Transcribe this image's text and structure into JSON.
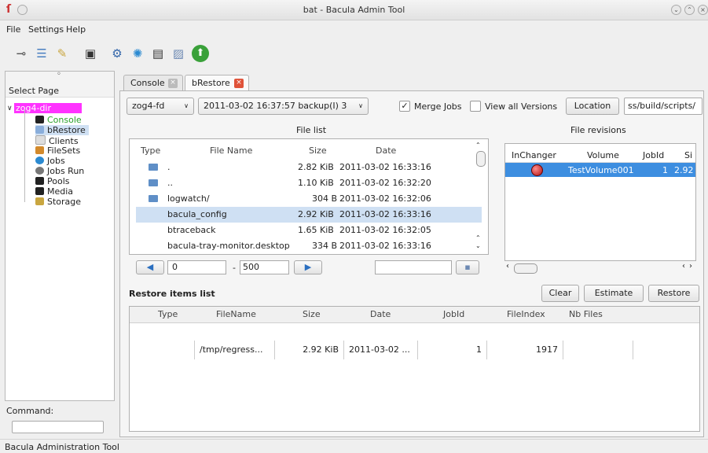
{
  "window": {
    "title": "bat - Bacula Admin Tool"
  },
  "menu": {
    "file": "File",
    "settings": "Settings",
    "help": "Help"
  },
  "sidebar": {
    "header": "Select Page",
    "root": "zog4-dir",
    "items": [
      "Console",
      "bRestore",
      "Clients",
      "FileSets",
      "Jobs",
      "Jobs Run",
      "Pools",
      "Media",
      "Storage"
    ]
  },
  "command": {
    "label": "Command:",
    "value": ""
  },
  "status": {
    "text": "Bacula Administration Tool"
  },
  "tabs": [
    {
      "label": "Console"
    },
    {
      "label": "bRestore"
    }
  ],
  "restore": {
    "client": "zog4-fd",
    "job": "2011-03-02 16:37:57 backup(I) 3",
    "merge_jobs": "Merge Jobs",
    "view_all_versions": "View all Versions",
    "location_button": "Location",
    "location_value": "ss/build/scripts/",
    "file_list_title": "File list",
    "file_revisions_title": "File revisions",
    "file_columns": [
      "Type",
      "File Name",
      "Size",
      "Date"
    ],
    "files": [
      {
        "name": ".",
        "size": "2.82 KiB",
        "date": "2011-03-02 16:33:16",
        "type": "folder"
      },
      {
        "name": "..",
        "size": "1.10 KiB",
        "date": "2011-03-02 16:32:20",
        "type": "folder"
      },
      {
        "name": "logwatch/",
        "size": "304 B",
        "date": "2011-03-02 16:32:06",
        "type": "folder"
      },
      {
        "name": "bacula_config",
        "size": "2.92 KiB",
        "date": "2011-03-02 16:33:16",
        "type": "file"
      },
      {
        "name": "btraceback",
        "size": "1.65 KiB",
        "date": "2011-03-02 16:32:05",
        "type": "file"
      },
      {
        "name": "bacula-tray-monitor.desktop",
        "size": "334 B",
        "date": "2011-03-02 16:33:16",
        "type": "file"
      }
    ],
    "pager": {
      "from": "0",
      "to": "500",
      "dash": "-"
    },
    "rev_columns": [
      "InChanger",
      "Volume",
      "JobId",
      "Si"
    ],
    "revisions": [
      {
        "volume": "TestVolume001",
        "jobid": "1",
        "size": "2.92"
      }
    ],
    "restore_items_title": "Restore items list",
    "clear": "Clear",
    "estimate": "Estimate",
    "restore_button": "Restore",
    "restore_columns": [
      "Type",
      "FileName",
      "Size",
      "Date",
      "JobId",
      "FileIndex",
      "Nb Files"
    ],
    "restore_items": [
      {
        "type": "",
        "filename": "/tmp/regress...",
        "size": "2.92 KiB",
        "date": "2011-03-02 ...",
        "jobid": "1",
        "fileindex": "1917",
        "nbfiles": ""
      }
    ]
  },
  "colors": {
    "selection": "#cfe0f3",
    "root_highlight": "#ff33ff",
    "accent_tab_close": "#e0533a",
    "revision_row": "#3d8ee0"
  }
}
